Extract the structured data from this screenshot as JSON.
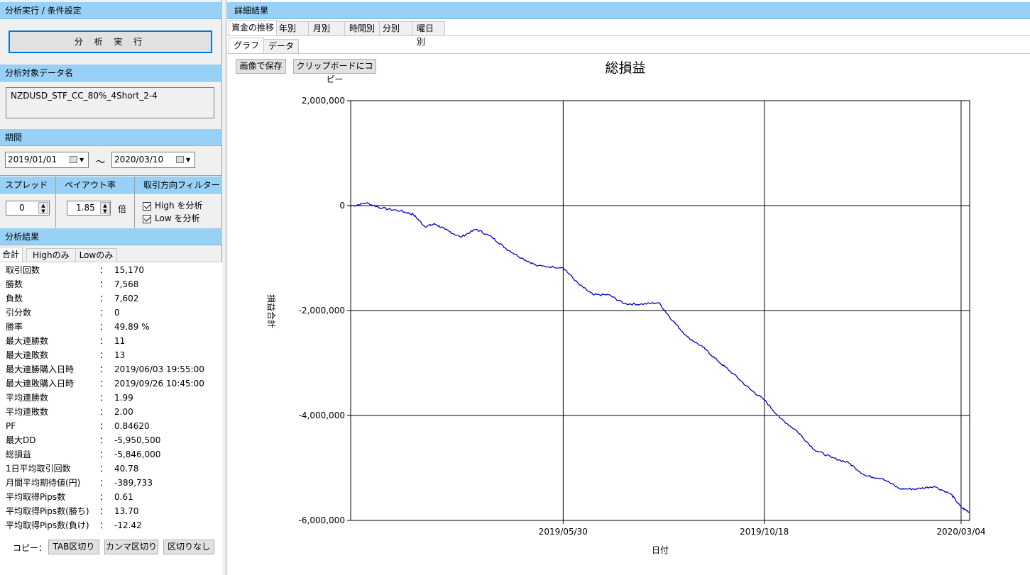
{
  "left": {
    "title": "分析実行 / 条件設定",
    "run_button": "分 析 実 行",
    "target_header": "分析対象データ名",
    "target_name": "NZDUSD_STF_CC_80%_4Short_2-4",
    "period_header": "期間",
    "period_from": "2019/01/01",
    "period_to": "2020/03/10",
    "period_sep": "～",
    "spread_header": "スプレッド",
    "spread_value": "0",
    "payout_header": "ペイアウト率",
    "payout_value": "1.85",
    "payout_unit": "倍",
    "filter_header": "取引方向フィルター",
    "filter_high": "High を分析",
    "filter_low": "Low を分析",
    "result_header": "分析結果",
    "result_tabs": [
      "合計",
      "Highのみ",
      "Lowのみ"
    ],
    "colon": "：",
    "stats": [
      {
        "label": "取引回数",
        "value": "15,170"
      },
      {
        "label": "勝数",
        "value": "7,568"
      },
      {
        "label": "負数",
        "value": "7,602"
      },
      {
        "label": "引分数",
        "value": "0"
      },
      {
        "label": "勝率",
        "value": "49.89 %"
      },
      {
        "label": "最大連勝数",
        "value": "11"
      },
      {
        "label": "最大連敗数",
        "value": "13"
      },
      {
        "label": "最大連勝購入日時",
        "value": "2019/06/03 19:55:00"
      },
      {
        "label": "最大連敗購入日時",
        "value": "2019/09/26 10:45:00"
      },
      {
        "label": "平均連勝数",
        "value": "1.99"
      },
      {
        "label": "平均連敗数",
        "value": "2.00"
      },
      {
        "label": "PF",
        "value": "0.84620"
      },
      {
        "label": "最大DD",
        "value": "-5,950,500"
      },
      {
        "label": "総損益",
        "value": "-5,846,000"
      },
      {
        "label": "1日平均取引回数",
        "value": "40.78"
      },
      {
        "label": "月間平均期待値(円)",
        "value": "-389,733"
      },
      {
        "label": "平均取得Pips数",
        "value": "0.61"
      },
      {
        "label": "平均取得Pips数(勝ち)",
        "value": "13.70"
      },
      {
        "label": "平均取得Pips数(負け)",
        "value": "-12.42"
      }
    ],
    "copy_label": "コピー：",
    "copy_tab": "TAB区切り",
    "copy_comma": "カンマ区切り",
    "copy_none": "区切りなし"
  },
  "right": {
    "title": "詳細結果",
    "tabs": [
      "資金の推移",
      "年別",
      "月別",
      "時間別",
      "分別",
      "曜日別"
    ],
    "subtabs": [
      "グラフ",
      "データ"
    ],
    "save_image": "画像で保存",
    "copy_clipboard": "クリップボードにコピー"
  },
  "chart_data": {
    "type": "line",
    "title": "総損益",
    "xlabel": "日付",
    "ylabel": "損益合計",
    "ylim": [
      -6000000,
      2000000
    ],
    "yticks": [
      "2,000,000",
      "0",
      "-2,000,000",
      "-4,000,000",
      "-6,000,000"
    ],
    "yticks_values": [
      2000000,
      0,
      -2000000,
      -4000000,
      -6000000
    ],
    "xticks": [
      "2019/05/30",
      "2019/10/18",
      "2020/03/04"
    ],
    "xlim": [
      "2019/01/01",
      "2020/03/10"
    ],
    "grid": true,
    "line_color": "#0000cc",
    "series": [
      {
        "x": [
          "2019/01/01",
          "2019/01/12",
          "2019/01/23",
          "2019/02/05",
          "2019/02/14",
          "2019/02/22",
          "2019/03/01",
          "2019/03/08",
          "2019/03/19",
          "2019/03/30",
          "2019/04/10",
          "2019/04/20",
          "2019/05/01",
          "2019/05/12",
          "2019/05/30",
          "2019/06/10",
          "2019/06/20",
          "2019/07/01",
          "2019/07/12",
          "2019/07/23",
          "2019/08/05",
          "2019/08/15",
          "2019/08/25",
          "2019/09/05",
          "2019/09/15",
          "2019/09/26",
          "2019/10/08",
          "2019/10/18",
          "2019/10/29",
          "2019/11/10",
          "2019/11/22",
          "2019/12/04",
          "2019/12/16",
          "2019/12/28",
          "2020/01/09",
          "2020/01/21",
          "2020/02/02",
          "2020/02/14",
          "2020/02/26",
          "2020/03/04",
          "2020/03/10"
        ],
        "values": [
          -10000,
          50000,
          -50000,
          -100000,
          -170000,
          -400000,
          -350000,
          -450000,
          -600000,
          -450000,
          -600000,
          -820000,
          -1000000,
          -1150000,
          -1180000,
          -1500000,
          -1700000,
          -1700000,
          -1870000,
          -1880000,
          -1850000,
          -2200000,
          -2500000,
          -2700000,
          -2950000,
          -3200000,
          -3500000,
          -3700000,
          -4050000,
          -4300000,
          -4650000,
          -4800000,
          -4900000,
          -5150000,
          -5200000,
          -5400000,
          -5400000,
          -5350000,
          -5500000,
          -5750000,
          -5846000
        ]
      }
    ]
  }
}
